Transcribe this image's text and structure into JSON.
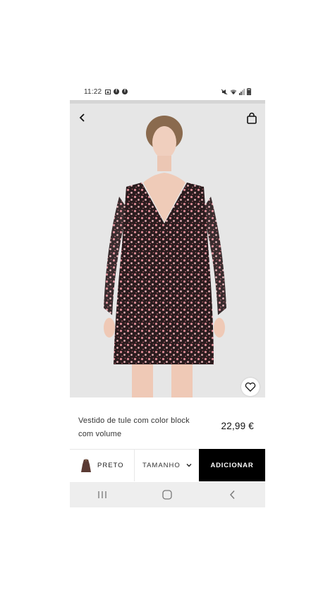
{
  "status_bar": {
    "time": "11:22",
    "left_icons": [
      "image-notification-icon",
      "facebook-icon",
      "facebook-icon"
    ],
    "right_icons": [
      "mute-icon",
      "wifi-icon",
      "signal-icon",
      "battery-icon"
    ]
  },
  "header": {
    "back_icon": "chevron-left-icon",
    "bag_icon": "shopping-bag-icon"
  },
  "product": {
    "image_alt": "Floral print mini dress",
    "name": "Vestido de tule com color block com volume",
    "price": "22,99 €",
    "favorite_icon": "heart-outline-icon"
  },
  "actions": {
    "color_label": "PRETO",
    "size_label": "TAMANHO",
    "add_label": "ADICIONAR"
  },
  "nav_bar": {
    "recent_icon": "recent-apps-icon",
    "home_icon": "home-icon",
    "back_icon": "back-icon"
  },
  "colors": {
    "background_image": "#e6e6e6",
    "add_button": "#000000",
    "nav_bar": "#eeeeee",
    "dress_base": "#2a1c1e",
    "dress_flowers": "#d98a94"
  }
}
